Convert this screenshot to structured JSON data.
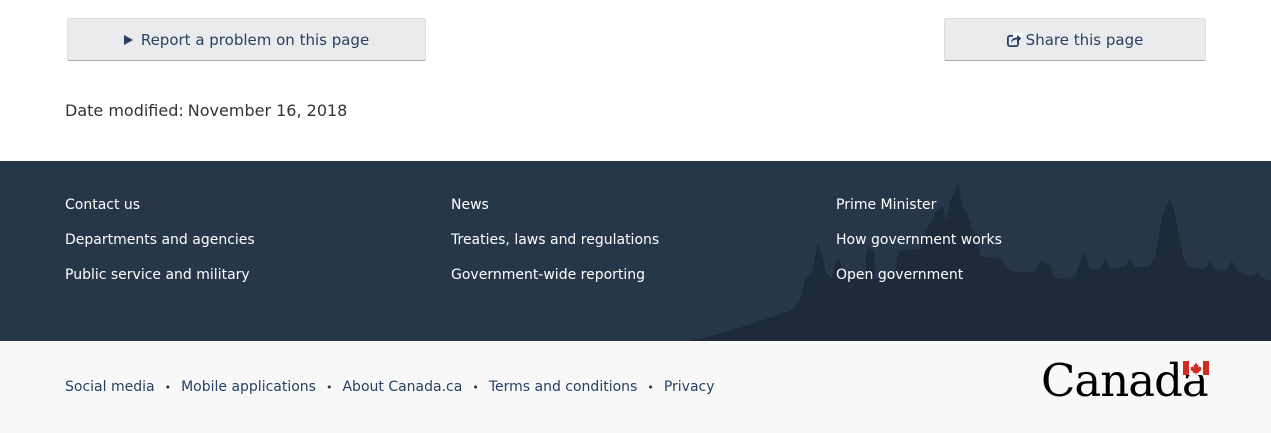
{
  "actions": {
    "report_label": "Report a problem on this page",
    "share_label": "Share this page"
  },
  "date_modified": {
    "label": "Date modified:",
    "value": "November 16, 2018"
  },
  "footer": {
    "columns": [
      [
        "Contact us",
        "Departments and agencies",
        "Public service and military"
      ],
      [
        "News",
        "Treaties, laws and regulations",
        "Government-wide reporting"
      ],
      [
        "Prime Minister",
        "How government works",
        "Open government"
      ]
    ]
  },
  "sub_footer": {
    "links": [
      "Social media",
      "Mobile applications",
      "About Canada.ca",
      "Terms and conditions",
      "Privacy"
    ],
    "separator": "•",
    "wordmark": "Canada"
  },
  "colors": {
    "footer_bg": "#26374a",
    "link": "#284162",
    "button_bg": "#eaebed",
    "flag_red": "#d52b1e"
  }
}
